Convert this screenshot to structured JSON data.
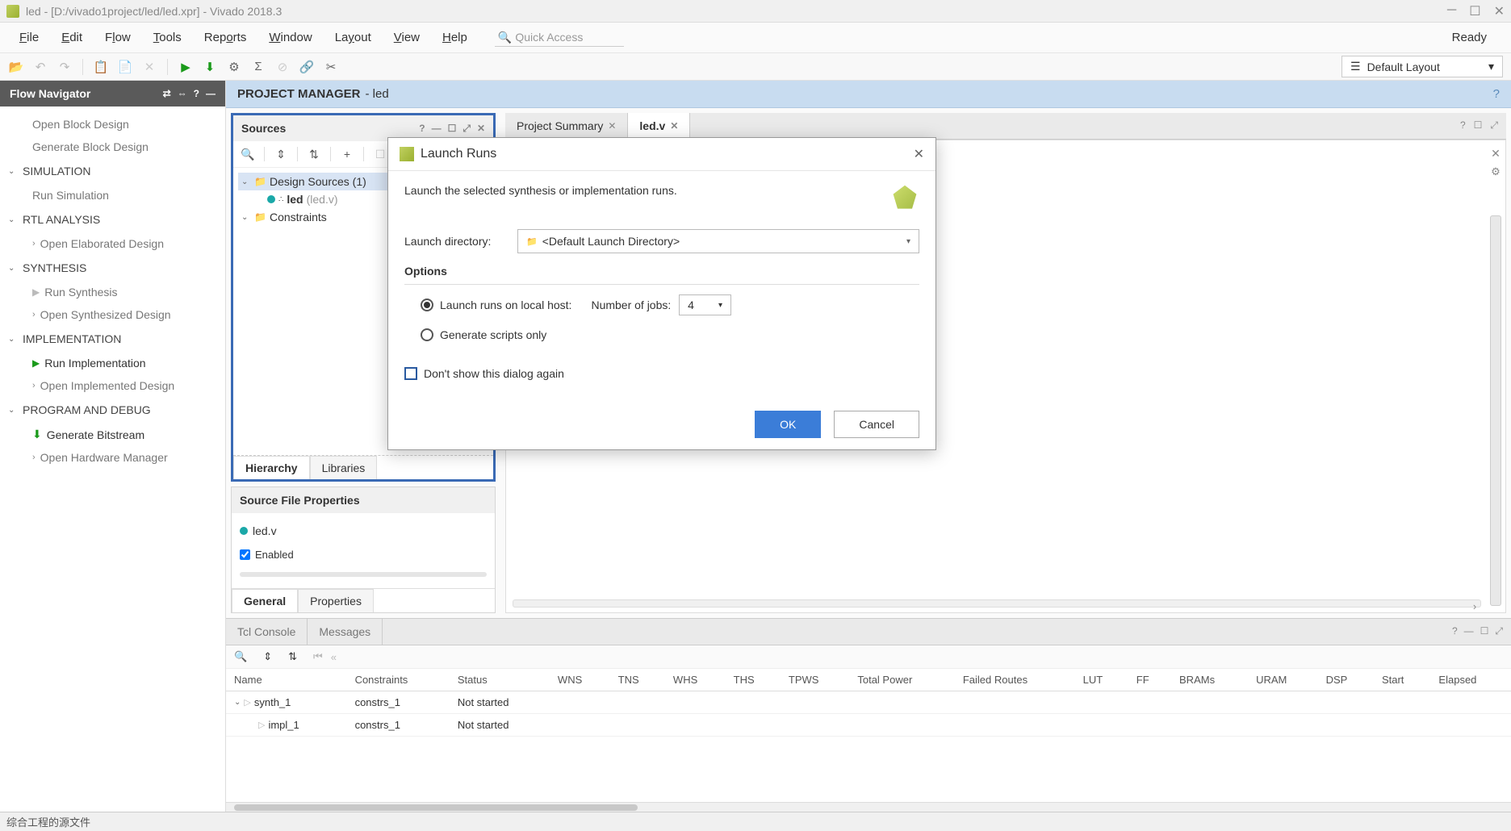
{
  "title": "led - [D:/vivado1project/led/led.xpr] - Vivado 2018.3",
  "menus": {
    "file": "File",
    "edit": "Edit",
    "flow": "Flow",
    "tools": "Tools",
    "reports": "Reports",
    "window": "Window",
    "layout": "Layout",
    "view": "View",
    "help": "Help"
  },
  "quick_access_placeholder": "Quick Access",
  "ready": "Ready",
  "layout_select": "Default Layout",
  "flow_navigator": {
    "title": "Flow Navigator",
    "items": {
      "open_block": "Open Block Design",
      "gen_block": "Generate Block Design",
      "simulation": "SIMULATION",
      "run_sim": "Run Simulation",
      "rtl": "RTL ANALYSIS",
      "open_elab": "Open Elaborated Design",
      "synth": "SYNTHESIS",
      "run_synth": "Run Synthesis",
      "open_synth": "Open Synthesized Design",
      "impl": "IMPLEMENTATION",
      "run_impl": "Run Implementation",
      "open_impl": "Open Implemented Design",
      "prog": "PROGRAM AND DEBUG",
      "gen_bit": "Generate Bitstream",
      "open_hw": "Open Hardware Manager"
    }
  },
  "pm_header": {
    "title": "PROJECT MANAGER",
    "project": "- led"
  },
  "sources": {
    "title": "Sources",
    "design_sources": "Design Sources (1)",
    "led_name": "led",
    "led_file": "(led.v)",
    "constraints": "Constraints",
    "tabs": {
      "hierarchy": "Hierarchy",
      "libraries": "Libraries"
    }
  },
  "src_props": {
    "title": "Source File Properties",
    "file": "led.v",
    "enabled": "Enabled",
    "tabs": {
      "general": "General",
      "properties": "Properties"
    }
  },
  "editor": {
    "tabs": {
      "summary": "Project Summary",
      "ledv": "led.v"
    }
  },
  "bottom": {
    "tabs": {
      "tcl": "Tcl Console",
      "messages": "Messages"
    },
    "cols": [
      "Name",
      "Constraints",
      "Status",
      "WNS",
      "TNS",
      "WHS",
      "THS",
      "TPWS",
      "Total Power",
      "Failed Routes",
      "LUT",
      "FF",
      "BRAMs",
      "URAM",
      "DSP",
      "Start",
      "Elapsed"
    ],
    "rows": [
      {
        "name": "synth_1",
        "constraints": "constrs_1",
        "status": "Not started",
        "indent": 0
      },
      {
        "name": "impl_1",
        "constraints": "constrs_1",
        "status": "Not started",
        "indent": 1
      }
    ]
  },
  "statusbar": "综合工程的源文件",
  "dialog": {
    "title": "Launch Runs",
    "desc": "Launch the selected synthesis or implementation runs.",
    "launch_dir_label": "Launch directory:",
    "launch_dir_value": "<Default Launch Directory>",
    "options_title": "Options",
    "opt_local": "Launch runs on local host:",
    "njobs_label": "Number of jobs:",
    "njobs_value": "4",
    "opt_scripts": "Generate scripts only",
    "dont_show": "Don't show this dialog again",
    "ok": "OK",
    "cancel": "Cancel"
  }
}
